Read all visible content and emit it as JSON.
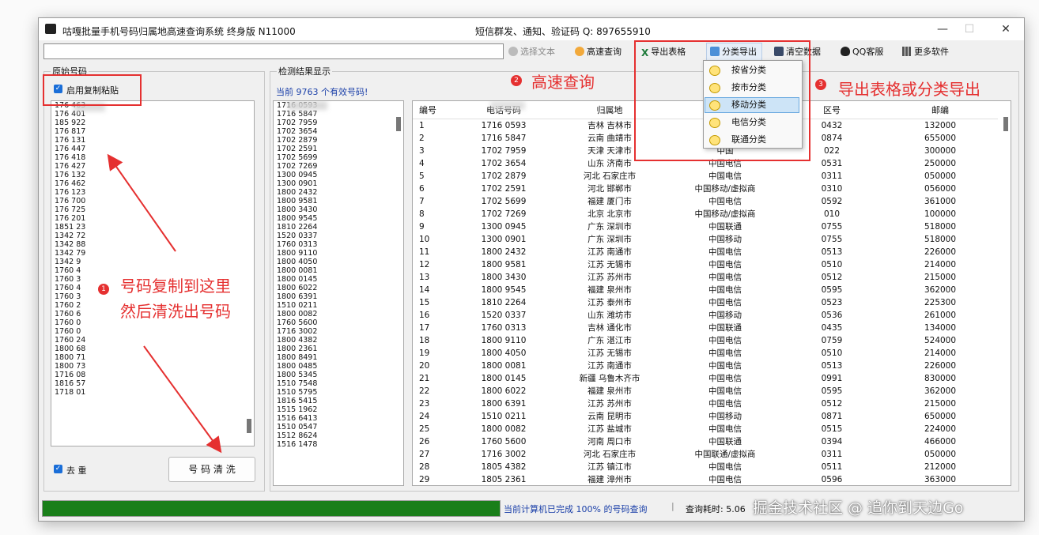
{
  "window": {
    "title": "咕嘎批量手机号码归属地高速查询系统 终身版  N11000",
    "subtitle": "短信群发、通知、验证码 Q: 897655910",
    "controls": [
      "—",
      "☐",
      "✕"
    ]
  },
  "toolbar": {
    "input_value": "",
    "buttons": [
      "选择文本",
      "高速查询",
      "导出表格",
      "分类导出",
      "清空数据",
      "QQ客服",
      "更多软件"
    ]
  },
  "dropdown": {
    "items": [
      "按省分类",
      "按市分类",
      "移动分类",
      "电信分类",
      "联通分类"
    ],
    "selected": "移动分类"
  },
  "left_panel": {
    "label": "原始号码",
    "checkbox_label": "启用复制粘贴",
    "dedupe_label": "去 重",
    "clean_button": "号 码 清 洗",
    "numbers": [
      "176  463",
      "176  401",
      "185  922",
      "176  817",
      "176  131",
      "176  447",
      "176  418",
      "176  427",
      "176  132",
      "176  462",
      "176  123",
      "176  700",
      "176  725",
      "176  201",
      "1851  23",
      "1342  72",
      "1342  88",
      "1342  79",
      "1342  9",
      "1760  4",
      "1760  3",
      "1760  4",
      "1760  3",
      "1760  2",
      "1760  6",
      "1760  0",
      "1760  0",
      "1760  24",
      "1800  68",
      "1800  71",
      "1800  73",
      "1716  08",
      "1816  57",
      "1718  01"
    ]
  },
  "middle_panel": {
    "label": "检测结果显示",
    "summary": "当前  9763  个有效号码!",
    "numbers": [
      "1716  0593",
      "1716  5847",
      "1702  7959",
      "1702  3654",
      "1702  2879",
      "1702  2591",
      "1702  5699",
      "1702  7269",
      "1300  0945",
      "1300  0901",
      "1800  2432",
      "1800  9581",
      "1800  3430",
      "1800  9545",
      "1810  2264",
      "1520  0337",
      "1760  0313",
      "1800  9110",
      "1800  4050",
      "1800  0081",
      "1800  0145",
      "1800  6022",
      "1800  6391",
      "1510  0211",
      "1800  0082",
      "1760  5600",
      "1716  3002",
      "1800  4382",
      "1800  2361",
      "1800  8491",
      "1800  0485",
      "1800  5345",
      "1510  7548",
      "1510  5795",
      "1816  5415",
      "1515  1962",
      "1516  6413",
      "1510  0547",
      "1512  8624",
      "1516  1478"
    ]
  },
  "results": {
    "headers": [
      "编号",
      "电话号码",
      "归属地",
      "",
      "区号",
      "邮编"
    ],
    "rows": [
      [
        "1",
        "1716  0593",
        "吉林  吉林市",
        "中国",
        "0432",
        "132000"
      ],
      [
        "2",
        "1716  5847",
        "云南  曲靖市",
        "中国",
        "0874",
        "655000"
      ],
      [
        "3",
        "1702  7959",
        "天津  天津市",
        "中国",
        "022",
        "300000"
      ],
      [
        "4",
        "1702  3654",
        "山东  济南市",
        "中国电信",
        "0531",
        "250000"
      ],
      [
        "5",
        "1702  2879",
        "河北  石家庄市",
        "中国电信",
        "0311",
        "050000"
      ],
      [
        "6",
        "1702  2591",
        "河北  邯郸市",
        "中国移动/虚拟商",
        "0310",
        "056000"
      ],
      [
        "7",
        "1702  5699",
        "福建  厦门市",
        "中国电信",
        "0592",
        "361000"
      ],
      [
        "8",
        "1702  7269",
        "北京  北京市",
        "中国移动/虚拟商",
        "010",
        "100000"
      ],
      [
        "9",
        "1300  0945",
        "广东  深圳市",
        "中国联通",
        "0755",
        "518000"
      ],
      [
        "10",
        "1300  0901",
        "广东  深圳市",
        "中国移动",
        "0755",
        "518000"
      ],
      [
        "11",
        "1800  2432",
        "江苏  南通市",
        "中国电信",
        "0513",
        "226000"
      ],
      [
        "12",
        "1800  9581",
        "江苏  无锡市",
        "中国电信",
        "0510",
        "214000"
      ],
      [
        "13",
        "1800  3430",
        "江苏  苏州市",
        "中国电信",
        "0512",
        "215000"
      ],
      [
        "14",
        "1800  9545",
        "福建  泉州市",
        "中国电信",
        "0595",
        "362000"
      ],
      [
        "15",
        "1810  2264",
        "江苏  泰州市",
        "中国电信",
        "0523",
        "225300"
      ],
      [
        "16",
        "1520  0337",
        "山东  潍坊市",
        "中国移动",
        "0536",
        "261000"
      ],
      [
        "17",
        "1760  0313",
        "吉林  通化市",
        "中国联通",
        "0435",
        "134000"
      ],
      [
        "18",
        "1800  9110",
        "广东  湛江市",
        "中国电信",
        "0759",
        "524000"
      ],
      [
        "19",
        "1800  4050",
        "江苏  无锡市",
        "中国电信",
        "0510",
        "214000"
      ],
      [
        "20",
        "1800  0081",
        "江苏  南通市",
        "中国电信",
        "0513",
        "226000"
      ],
      [
        "21",
        "1800  0145",
        "新疆  乌鲁木齐市",
        "中国电信",
        "0991",
        "830000"
      ],
      [
        "22",
        "1800  6022",
        "福建  泉州市",
        "中国电信",
        "0595",
        "362000"
      ],
      [
        "23",
        "1800  6391",
        "江苏  苏州市",
        "中国电信",
        "0512",
        "215000"
      ],
      [
        "24",
        "1510  0211",
        "云南  昆明市",
        "中国移动",
        "0871",
        "650000"
      ],
      [
        "25",
        "1800  0082",
        "江苏  盐城市",
        "中国电信",
        "0515",
        "224000"
      ],
      [
        "26",
        "1760  5600",
        "河南  周口市",
        "中国联通",
        "0394",
        "466000"
      ],
      [
        "27",
        "1716  3002",
        "河北  石家庄市",
        "中国联通/虚拟商",
        "0311",
        "050000"
      ],
      [
        "28",
        "1805  4382",
        "江苏  镇江市",
        "中国电信",
        "0511",
        "212000"
      ],
      [
        "29",
        "1805  2361",
        "福建  漳州市",
        "中国电信",
        "0596",
        "363000"
      ]
    ]
  },
  "status": {
    "progress_percent": 100,
    "text": "当前计算机已完成 100% 的号码查询",
    "time_label": "查询耗时: 5.06"
  },
  "annotations": {
    "n1": "1",
    "n2": "2",
    "n3": "3",
    "copy_line1": "号码复制到这里",
    "copy_line2": "然后清洗出号码",
    "fast_query": "高速查询",
    "export": "导出表格或分类导出"
  },
  "watermark": "掘金技术社区 @ 追你到天边Go",
  "colors": {
    "accent": "#1a6ed8",
    "progress": "#1a7f1a",
    "annotation": "#e53030"
  }
}
